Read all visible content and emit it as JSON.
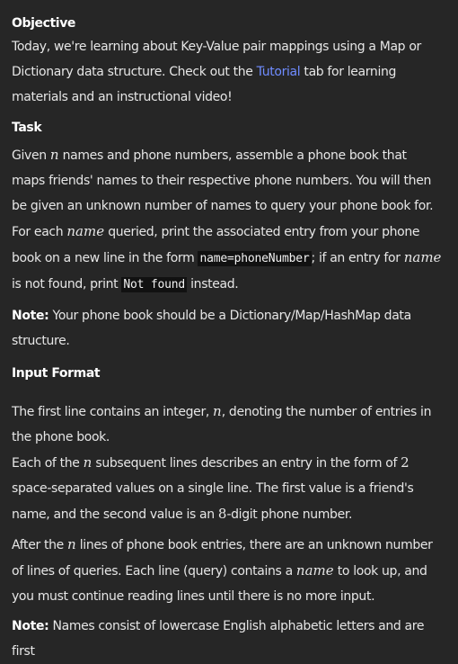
{
  "objective": {
    "heading": "Objective",
    "text_before": "Today, we're learning about Key-Value pair mappings using a Map or Dictionary data structure. Check out the ",
    "link": "Tutorial",
    "text_after": " tab for learning materials and an instructional video!"
  },
  "task": {
    "heading": "Task",
    "t1": "Given ",
    "n": "n",
    "t2": " names and phone numbers, assemble a phone book that maps friends' names to their respective phone numbers. You will then be given an unknown number of names to query your phone book for. For each ",
    "name_var": "name",
    "t3": " queried, print the associated entry from your phone book on a new line in the form ",
    "code_format": "name=phoneNumber",
    "t4": "; if an entry for ",
    "t5": " is not found, print ",
    "code_notfound": "Not found",
    "t6": " instead."
  },
  "note1": {
    "label": "Note:",
    "text": " Your phone book should be a Dictionary/Map/HashMap data structure."
  },
  "input_format": {
    "heading": "Input Format",
    "p1_a": "The first line contains an integer, ",
    "p1_var": "n",
    "p1_b": ", denoting the number of entries in the phone book.",
    "p2_a": "Each of the ",
    "p2_var": "n",
    "p2_b": " subsequent lines describes an entry in the form of ",
    "p2_num": "2",
    "p2_c": " space-separated values on a single line. The first value is a friend's name, and the second value is an ",
    "p2_num8": "8",
    "p2_d": "-digit phone number.",
    "p3_a": "After the ",
    "p3_var": "n",
    "p3_b": " lines of phone book entries, there are an unknown number of lines of queries. Each line (query) contains a ",
    "p3_var2": "name",
    "p3_c": " to look up, and you must continue reading lines until there is no more input."
  },
  "note2": {
    "label": "Note:",
    "text": " Names consist of lowercase English alphabetic letters and are first"
  }
}
